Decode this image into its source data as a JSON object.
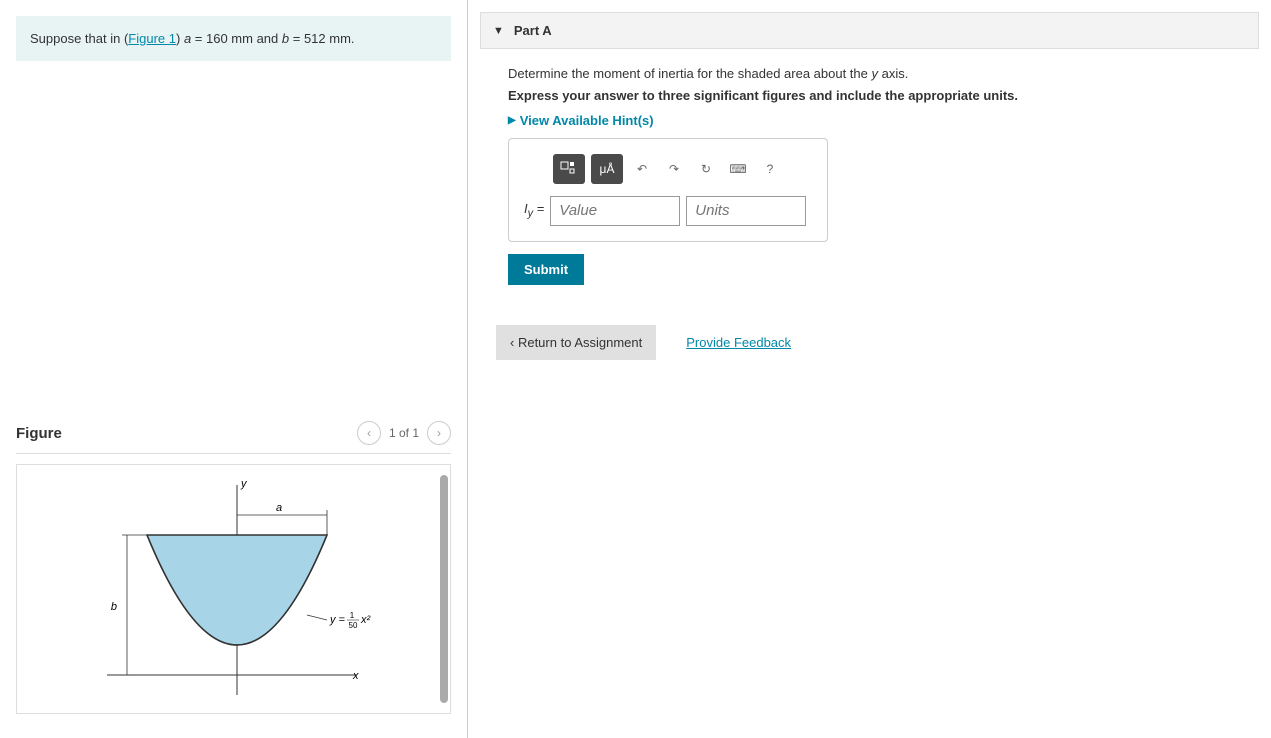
{
  "problem": {
    "prefix": "Suppose that in (",
    "figure_link": "Figure 1",
    "middle": ") ",
    "var_a": "a",
    "a_text": " = 160 mm and ",
    "var_b": "b",
    "b_text": " = 512 mm."
  },
  "figure": {
    "title": "Figure",
    "nav": "1 of 1",
    "equation": "y = (1/50) x²",
    "labels": {
      "a": "a",
      "b": "b",
      "x": "x",
      "y": "y"
    }
  },
  "part": {
    "label": "Part A",
    "question_prefix": "Determine the moment of inertia for the shaded area about the ",
    "axis_var": "y",
    "question_suffix": " axis.",
    "instruction": "Express your answer to three significant figures and include the appropriate units.",
    "hints": "View Available Hint(s)",
    "answer_label": "Iᵧ =",
    "value_placeholder": "Value",
    "units_placeholder": "Units",
    "submit": "Submit"
  },
  "toolbar": {
    "templates": "□",
    "symbols": "μÅ",
    "undo": "↶",
    "redo": "↷",
    "reset": "↻",
    "keyboard": "⌨",
    "help": "?"
  },
  "bottom": {
    "return": "Return to Assignment",
    "feedback": "Provide Feedback"
  }
}
